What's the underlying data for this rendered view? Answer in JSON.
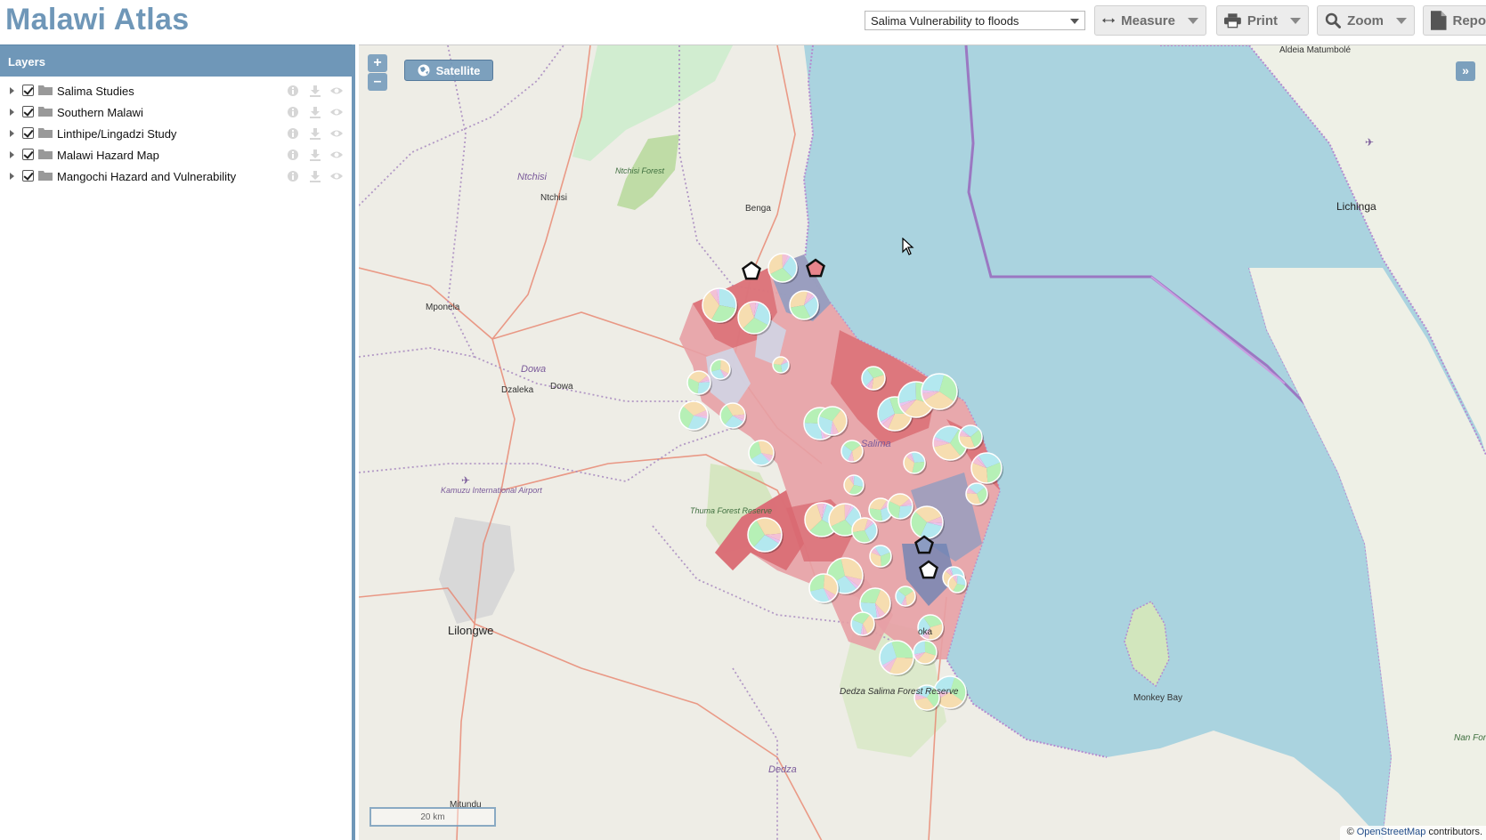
{
  "app": {
    "title": "Malawi Atlas"
  },
  "toolbar": {
    "study_select": "Salima Vulnerability to floods",
    "measure_label": "Measure",
    "print_label": "Print",
    "zoom_label": "Zoom",
    "report_label": "Repo"
  },
  "sidebar": {
    "header": "Layers",
    "layers": [
      {
        "label": "Salima Studies",
        "checked": true
      },
      {
        "label": "Southern Malawi",
        "checked": true
      },
      {
        "label": "Linthipe/Lingadzi Study",
        "checked": true
      },
      {
        "label": "Malawi Hazard Map",
        "checked": true
      },
      {
        "label": "Mangochi Hazard and Vulnerability",
        "checked": true
      }
    ]
  },
  "map": {
    "zoom_in": "+",
    "zoom_out": "–",
    "satellite_label": "Satellite",
    "expand_label": "»",
    "scale_label": "20 km",
    "attribution_prefix": "©",
    "attribution_link": "OpenStreetMap",
    "attribution_suffix": "contributors.",
    "places": {
      "nchisi_district": "Ntchisi",
      "nchisi_town": "Ntchisi",
      "ntchisi_forest": "Ntchisi Forest",
      "benga": "Benga",
      "mponela": "Mponela",
      "dowa_district": "Dowa",
      "dzaleka": "Dzaleka",
      "dowa_town": "Dowa",
      "kamuzu_airport": "Kamuzu International Airport",
      "lilongwe": "Lilongwe",
      "thuma": "Thuma Forest Reserve",
      "salima": "Salima",
      "chipoka": "oka",
      "dedza_salima": "Dedza Salima Forest Reserve",
      "dedza": "Dedza",
      "mitundu": "Mitundu",
      "monkey_bay": "Monkey Bay",
      "lichinga": "Lichinga",
      "aldeia": "Aldeia Matumbolé",
      "nan_forest": "Nan Fores"
    },
    "colors": {
      "lake": "#aad3df",
      "land": "#eeede6",
      "vulnerability_high": "#d96a72",
      "vulnerability_mid": "#e7a0a5",
      "vulnerability_low": "#8c9cc2",
      "forest": "#c8e1b3",
      "border_intl": "#a87cc8",
      "accent": "#6f97b8"
    }
  }
}
